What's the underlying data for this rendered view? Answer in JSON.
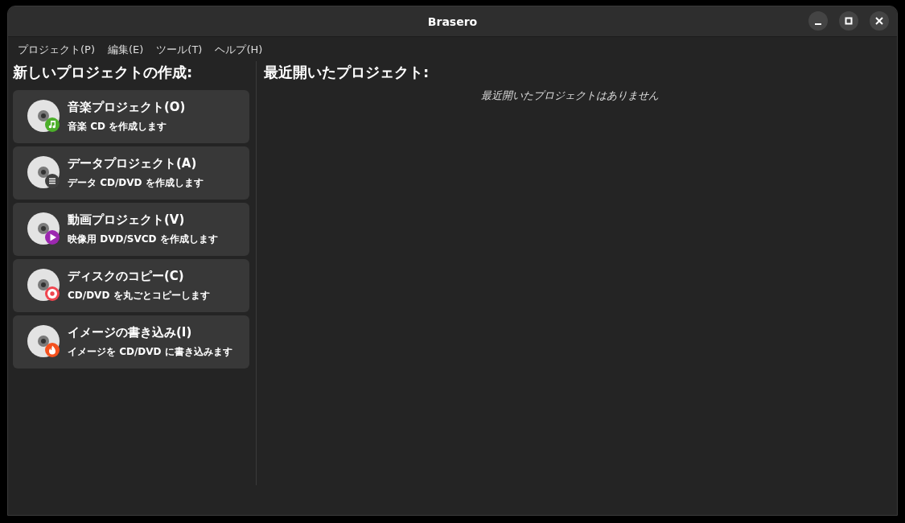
{
  "window": {
    "title": "Brasero"
  },
  "menu": [
    "プロジェクト(P)",
    "編集(E)",
    "ツール(T)",
    "ヘルプ(H)"
  ],
  "new_project": {
    "heading": "新しいプロジェクトの作成:",
    "items": [
      {
        "title": "音楽プロジェクト(O)",
        "subtitle": "音楽 CD を作成します",
        "kind": "music",
        "color": "#4caf2a"
      },
      {
        "title": "データプロジェクト(A)",
        "subtitle": "データ CD/DVD を作成します",
        "kind": "list",
        "color": "#3f3f3f"
      },
      {
        "title": "動画プロジェクト(V)",
        "subtitle": "映像用 DVD/SVCD を作成します",
        "kind": "play",
        "color": "#9c27b0"
      },
      {
        "title": "ディスクのコピー(C)",
        "subtitle": "CD/DVD を丸ごとコピーします",
        "kind": "record",
        "color": "#f0454f"
      },
      {
        "title": "イメージの書き込み(I)",
        "subtitle": "イメージを CD/DVD に書き込みます",
        "kind": "fire",
        "color": "#f4511e"
      }
    ]
  },
  "recent": {
    "heading": "最近開いたプロジェクト:",
    "empty_text": "最近開いたプロジェクトはありません"
  }
}
